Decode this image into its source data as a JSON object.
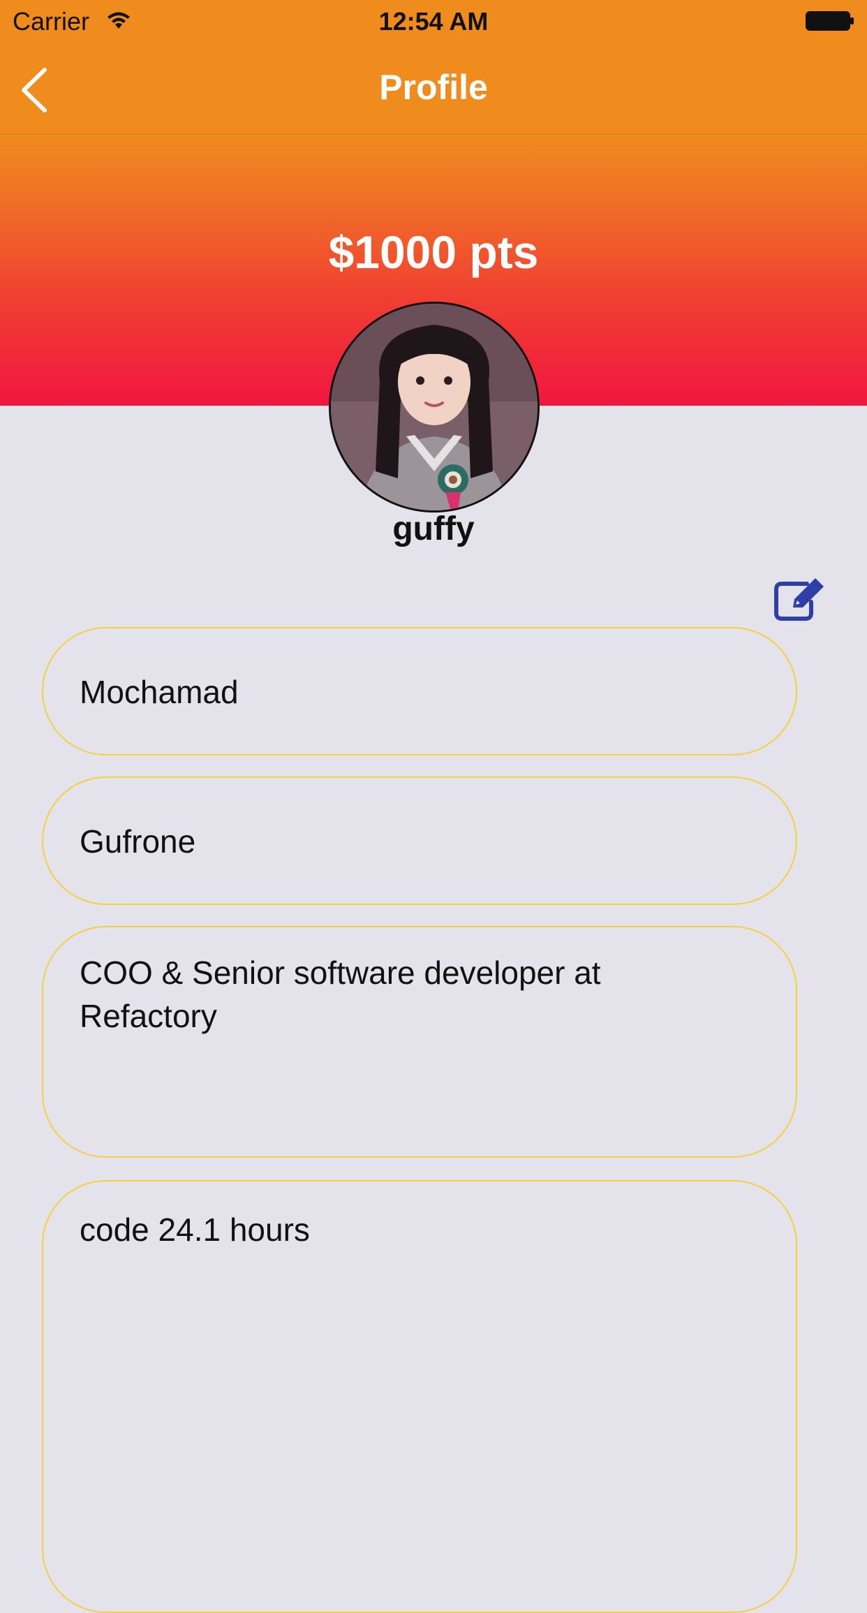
{
  "status_bar": {
    "carrier": "Carrier",
    "time": "12:54 AM",
    "wifi_icon": "wifi-icon",
    "battery_icon": "battery-icon"
  },
  "nav": {
    "title": "Profile",
    "back_icon": "chevron-left-icon"
  },
  "profile": {
    "points": "$1000 pts",
    "username": "guffy",
    "avatar": "profile-photo",
    "edit_icon": "edit-icon"
  },
  "fields": {
    "first_name": "Mochamad",
    "last_name": "Gufrone",
    "bio": "COO & Senior software developer at Refactory",
    "stats": "code 24.1 hours"
  },
  "colors": {
    "nav_bar": "#ef8c1d",
    "gradient_top": "#ef8c1d",
    "gradient_bottom": "#f1163f",
    "background": "#e4e3ec",
    "field_border": "#f4d03f",
    "edit_icon": "#2f3fa8"
  }
}
